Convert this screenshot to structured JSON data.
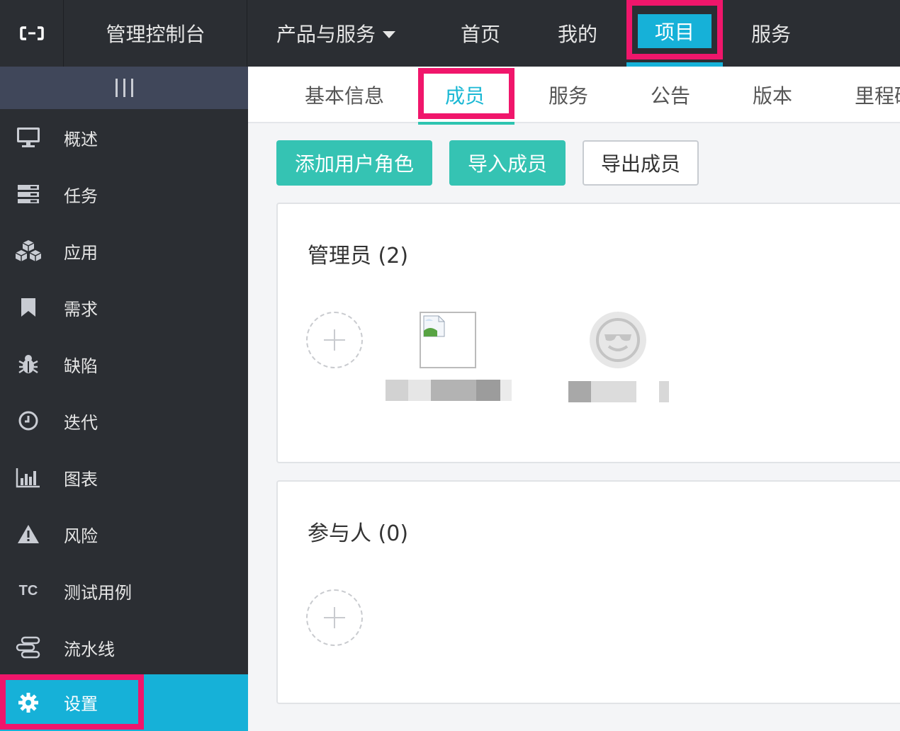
{
  "topbar": {
    "logo_icon": "cloud-logo-icon",
    "console_title": "管理控制台",
    "products_label": "产品与服务",
    "nav": [
      "首页",
      "我的",
      "项目",
      "服务"
    ],
    "active_nav": "项目"
  },
  "sidebar": {
    "collapse_icon": "collapse-bars-icon",
    "items": [
      {
        "label": "概述",
        "icon": "monitor-icon"
      },
      {
        "label": "任务",
        "icon": "task-list-icon"
      },
      {
        "label": "应用",
        "icon": "cubes-icon"
      },
      {
        "label": "需求",
        "icon": "bookmark-icon"
      },
      {
        "label": "缺陷",
        "icon": "bug-icon"
      },
      {
        "label": "迭代",
        "icon": "clock-icon"
      },
      {
        "label": "图表",
        "icon": "bar-chart-icon"
      },
      {
        "label": "风险",
        "icon": "warning-icon"
      },
      {
        "label": "测试用例",
        "icon": "tc-icon",
        "icon_text": "TC"
      },
      {
        "label": "流水线",
        "icon": "pipeline-icon"
      },
      {
        "label": "设置",
        "icon": "gear-icon"
      }
    ],
    "active": "设置"
  },
  "tabs": {
    "items": [
      "基本信息",
      "成员",
      "服务",
      "公告",
      "版本",
      "里程碑"
    ],
    "active": "成员"
  },
  "actions": {
    "add_role": "添加用户角色",
    "import": "导入成员",
    "export": "导出成员"
  },
  "admins": {
    "title": "管理员 (2)"
  },
  "participants": {
    "title": "参与人 (0)"
  },
  "colors": {
    "accent_teal": "#35c3b3",
    "accent_blue": "#16b1d8",
    "highlight_pink": "#f0166b",
    "dark_bg": "#2b2e33"
  }
}
